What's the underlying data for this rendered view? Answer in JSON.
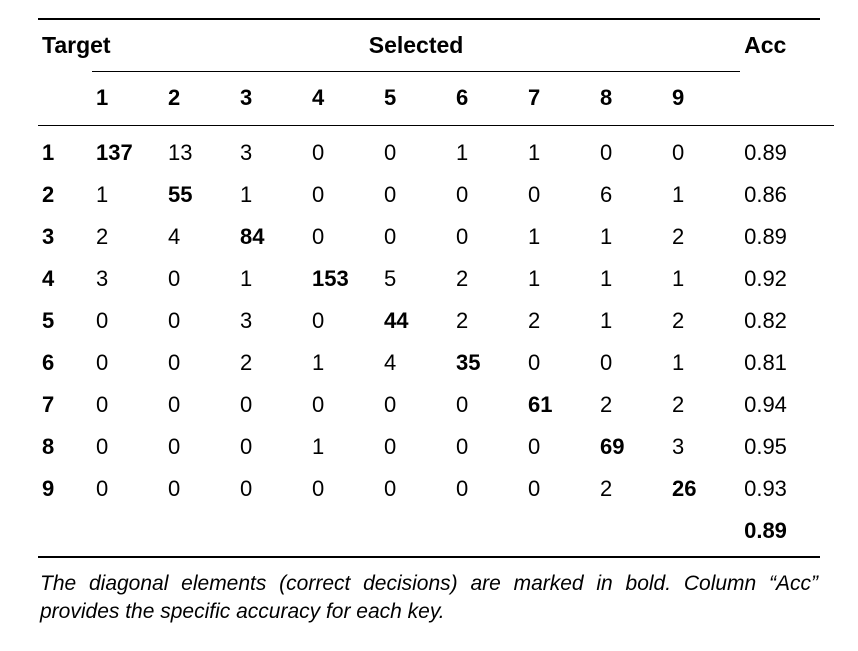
{
  "headers": {
    "target": "Target",
    "selected": "Selected",
    "acc": "Acc"
  },
  "col_labels": [
    "1",
    "2",
    "3",
    "4",
    "5",
    "6",
    "7",
    "8",
    "9"
  ],
  "rows": [
    {
      "label": "1",
      "cells": [
        "137",
        "13",
        "3",
        "0",
        "0",
        "1",
        "1",
        "0",
        "0"
      ],
      "acc": "0.89"
    },
    {
      "label": "2",
      "cells": [
        "1",
        "55",
        "1",
        "0",
        "0",
        "0",
        "0",
        "6",
        "1"
      ],
      "acc": "0.86"
    },
    {
      "label": "3",
      "cells": [
        "2",
        "4",
        "84",
        "0",
        "0",
        "0",
        "1",
        "1",
        "2"
      ],
      "acc": "0.89"
    },
    {
      "label": "4",
      "cells": [
        "3",
        "0",
        "1",
        "153",
        "5",
        "2",
        "1",
        "1",
        "1"
      ],
      "acc": "0.92"
    },
    {
      "label": "5",
      "cells": [
        "0",
        "0",
        "3",
        "0",
        "44",
        "2",
        "2",
        "1",
        "2"
      ],
      "acc": "0.82"
    },
    {
      "label": "6",
      "cells": [
        "0",
        "0",
        "2",
        "1",
        "4",
        "35",
        "0",
        "0",
        "1"
      ],
      "acc": "0.81"
    },
    {
      "label": "7",
      "cells": [
        "0",
        "0",
        "0",
        "0",
        "0",
        "0",
        "61",
        "2",
        "2"
      ],
      "acc": "0.94"
    },
    {
      "label": "8",
      "cells": [
        "0",
        "0",
        "0",
        "1",
        "0",
        "0",
        "0",
        "69",
        "3"
      ],
      "acc": "0.95"
    },
    {
      "label": "9",
      "cells": [
        "0",
        "0",
        "0",
        "0",
        "0",
        "0",
        "0",
        "2",
        "26"
      ],
      "acc": "0.93"
    }
  ],
  "overall_acc": "0.89",
  "caption": "The diagonal elements (correct decisions) are marked in bold. Column “Acc” provides the specific accuracy for each key.",
  "chart_data": {
    "type": "table",
    "title": "Confusion matrix with per-class accuracy",
    "row_label": "Target",
    "col_label": "Selected",
    "categories": [
      "1",
      "2",
      "3",
      "4",
      "5",
      "6",
      "7",
      "8",
      "9"
    ],
    "matrix": [
      [
        137,
        13,
        3,
        0,
        0,
        1,
        1,
        0,
        0
      ],
      [
        1,
        55,
        1,
        0,
        0,
        0,
        0,
        6,
        1
      ],
      [
        2,
        4,
        84,
        0,
        0,
        0,
        1,
        1,
        2
      ],
      [
        3,
        0,
        1,
        153,
        5,
        2,
        1,
        1,
        1
      ],
      [
        0,
        0,
        3,
        0,
        44,
        2,
        2,
        1,
        2
      ],
      [
        0,
        0,
        2,
        1,
        4,
        35,
        0,
        0,
        1
      ],
      [
        0,
        0,
        0,
        0,
        0,
        0,
        61,
        2,
        2
      ],
      [
        0,
        0,
        0,
        1,
        0,
        0,
        0,
        69,
        3
      ],
      [
        0,
        0,
        0,
        0,
        0,
        0,
        0,
        2,
        26
      ]
    ],
    "per_row_accuracy": [
      0.89,
      0.86,
      0.89,
      0.92,
      0.82,
      0.81,
      0.94,
      0.95,
      0.93
    ],
    "overall_accuracy": 0.89
  }
}
